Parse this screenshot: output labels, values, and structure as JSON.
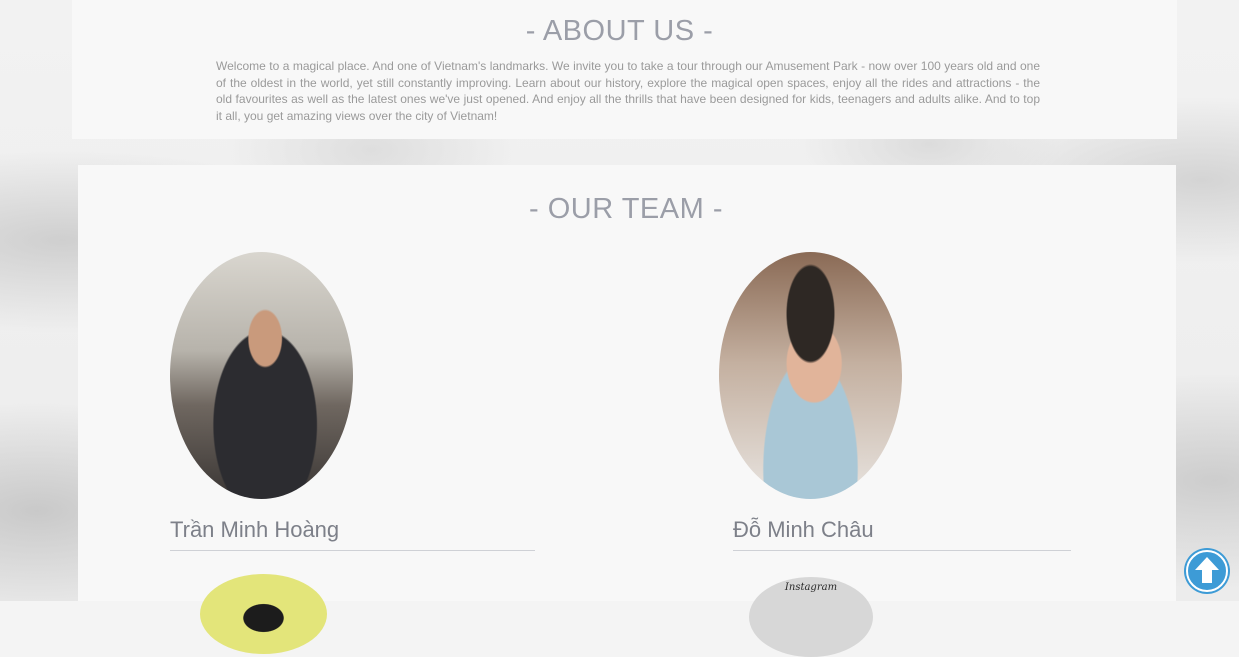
{
  "about": {
    "title": "- ABOUT US -",
    "text": "Welcome to a magical place. And one of Vietnam's landmarks. We invite you to take a tour through our Amusement Park - now over 100 years old and one of the oldest in the world, yet still constantly improving. Learn about our history, explore the magical open spaces, enjoy all the rides and attractions - the old favourites as well as the latest ones we've just opened. And enjoy all the thrills that have been designed for kids, teenagers and adults alike. And to top it all, you get amazing views over the city of Vietnam!"
  },
  "team": {
    "title": "- OUR TEAM -",
    "members": [
      {
        "name": "Trần Minh Hoàng"
      },
      {
        "name": "Đỗ Minh Châu"
      },
      {
        "name": ""
      },
      {
        "name": "",
        "photo_caption": "Instagram"
      }
    ]
  },
  "scroll_top": {
    "icon": "arrow-up-icon",
    "color": "#3d9bd6"
  },
  "colors": {
    "heading": "#9b9ea8",
    "body_text": "#9a9a9a",
    "name_text": "#7d8089",
    "accent": "#3d9bd6"
  }
}
